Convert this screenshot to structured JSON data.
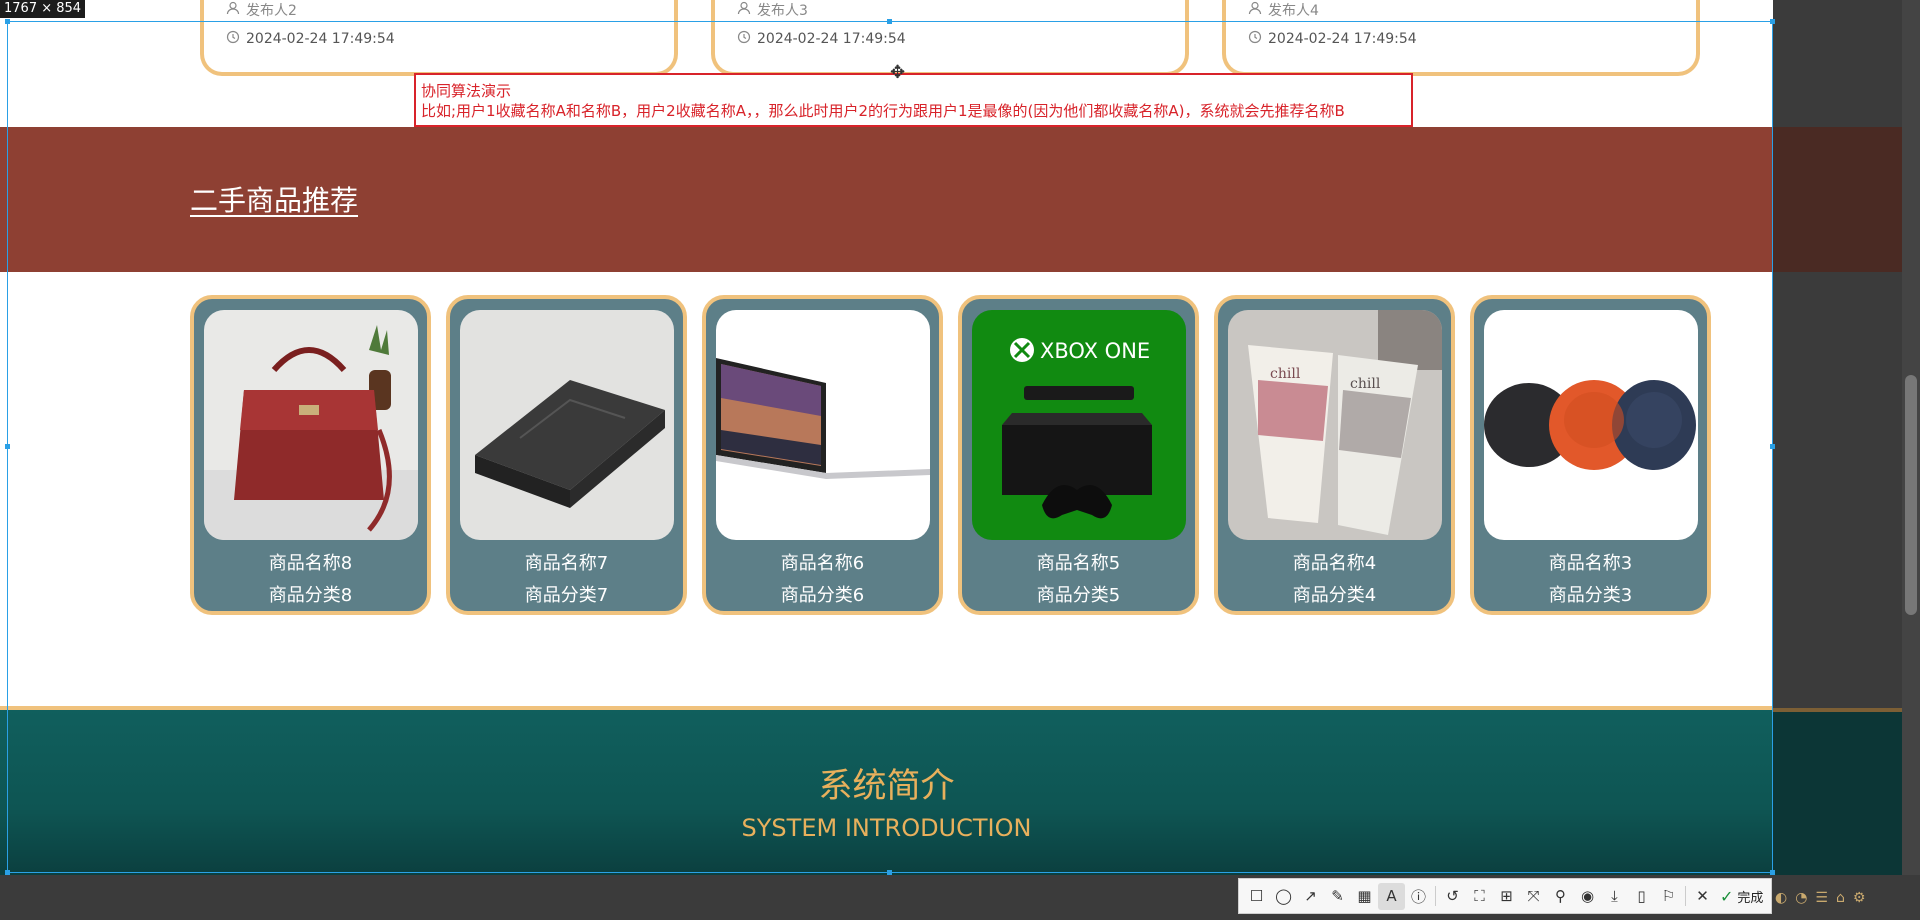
{
  "screenshot_size_label": "1767 × 854",
  "top_cards": [
    {
      "author": "发布人2",
      "time": "2024-02-24 17:49:54"
    },
    {
      "author": "发布人3",
      "time": "2024-02-24 17:49:54"
    },
    {
      "author": "发布人4",
      "time": "2024-02-24 17:49:54"
    }
  ],
  "annotation": {
    "title": "协同算法演示",
    "body": "比如;用户1收藏名称A和名称B，用户2收藏名称A，，那么此时用户2的行为跟用户1是最像的(因为他们都收藏名称A)，系统就会先推荐名称B"
  },
  "section": {
    "title": "二手商品推荐"
  },
  "products": [
    {
      "name": "商品名称8",
      "category": "商品分类8",
      "image": "red-handbag"
    },
    {
      "name": "商品名称7",
      "category": "商品分类7",
      "image": "black-laptop"
    },
    {
      "name": "商品名称6",
      "category": "商品分类6",
      "image": "macbook"
    },
    {
      "name": "商品名称5",
      "category": "商品分类5",
      "image": "xbox-one",
      "image_text": "XBOX ONE"
    },
    {
      "name": "商品名称4",
      "category": "商品分类4",
      "image": "cosmetic-tubes",
      "image_text": "chill"
    },
    {
      "name": "商品名称3",
      "category": "商品分类3",
      "image": "bluetooth-speakers"
    }
  ],
  "intro": {
    "title_zh": "系统简介",
    "title_en": "SYSTEM INTRODUCTION"
  },
  "toolbar": {
    "tools": [
      "rectangle-icon",
      "ellipse-icon",
      "arrow-icon",
      "pen-icon",
      "mosaic-icon",
      "text-icon",
      "number-icon",
      "undo-icon",
      "ocr-icon",
      "translate-icon",
      "scroll-capture-icon",
      "pin-icon",
      "record-icon",
      "download-icon",
      "save-icon",
      "bookmark-icon",
      "close-icon"
    ],
    "done_label": "完成"
  },
  "colors": {
    "accent_border": "#f0c27d",
    "banner_red": "#8e4033",
    "card_teal": "#5d7f88",
    "intro_teal": "#105f5d",
    "intro_text": "#e8b05c",
    "annotation_red": "#d8232a",
    "selection_blue": "#2aa0e6"
  }
}
